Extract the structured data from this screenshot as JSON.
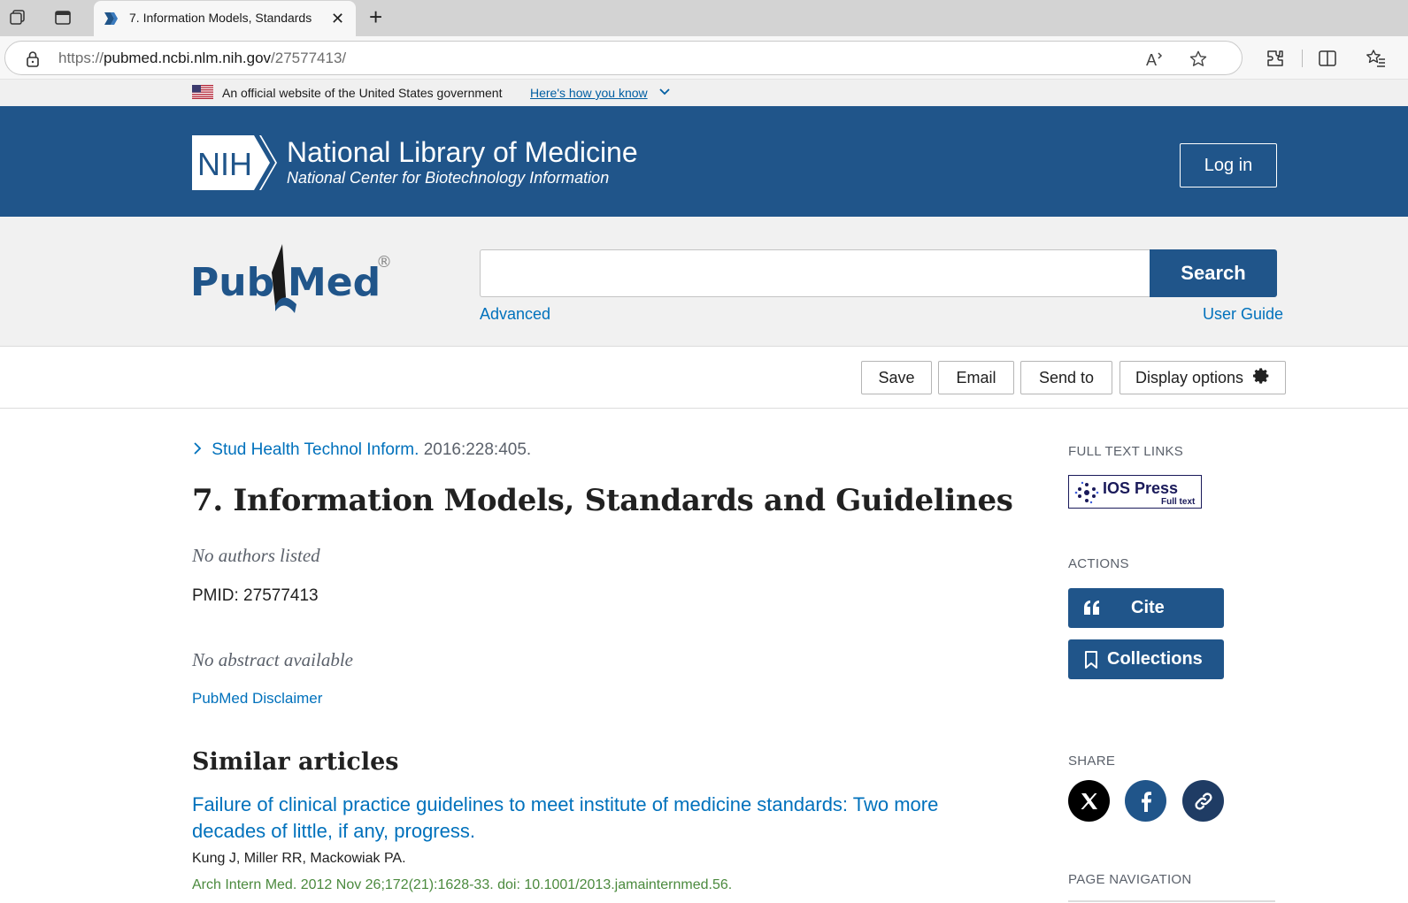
{
  "browser": {
    "tab_title": "7. Information Models, Standards",
    "url_scheme": "https://",
    "url_host": "pubmed.ncbi.nlm.nih.gov",
    "url_path": "/27577413/",
    "icons": [
      "workspaces-icon",
      "tab-actions-icon",
      "pubmed-favicon",
      "close-icon",
      "new-tab-icon",
      "lock-icon",
      "read-aloud-icon",
      "favorite-star-icon",
      "extensions-icon",
      "split-screen-icon",
      "favorites-list-icon"
    ]
  },
  "gov_banner": {
    "text": "An official website of the United States government",
    "link": "Here's how you know"
  },
  "ncbi_header": {
    "nih_logo": "NIH",
    "title": "National Library of Medicine",
    "subtitle": "National Center for Biotechnology Information",
    "login": "Log in",
    "color": "#20558a"
  },
  "search": {
    "logo": "PubMed",
    "logo_mark": "®",
    "placeholder": "",
    "button": "Search",
    "advanced": "Advanced",
    "user_guide": "User Guide"
  },
  "toolbar": {
    "save": "Save",
    "email": "Email",
    "send_to": "Send to",
    "display_options": "Display options"
  },
  "article": {
    "journal": "Stud Health Technol Inform.",
    "journal_info": "2016:228:405.",
    "title": "7. Information Models, Standards and Guidelines",
    "authors": "No authors listed",
    "pmid_label": "PMID: 27577413",
    "abstract": "No abstract available",
    "disclaimer": "PubMed Disclaimer"
  },
  "similar": {
    "heading": "Similar articles",
    "items": [
      {
        "title": "Failure of clinical practice guidelines to meet institute of medicine standards: Two more decades of little, if any, progress.",
        "authors": "Kung J, Miller RR, Mackowiak PA.",
        "citation": "Arch Intern Med. 2012 Nov 26;172(21):1628-33. doi: 10.1001/2013.jamainternmed.56."
      }
    ]
  },
  "sidebar": {
    "full_text_heading": "FULL TEXT LINKS",
    "ios_name": "IOS Press",
    "ios_fulltext": "Full text",
    "actions_heading": "ACTIONS",
    "cite": "Cite",
    "collections": "Collections",
    "share_heading": "SHARE",
    "share_icons": [
      "x-twitter-icon",
      "facebook-icon",
      "copy-link-icon"
    ],
    "page_nav_heading": "PAGE NAVIGATION"
  }
}
